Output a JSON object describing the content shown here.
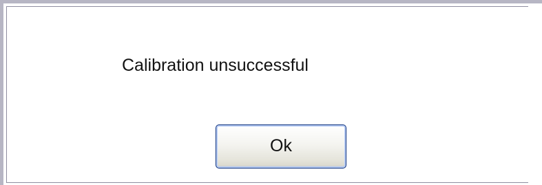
{
  "dialog": {
    "message": "Calibration unsuccessful",
    "ok_label": "Ok"
  },
  "colors": {
    "background": "#ffffff",
    "frame_border": "#b7b6c4",
    "button_border": "#0b2f7c",
    "text": "#111111"
  }
}
